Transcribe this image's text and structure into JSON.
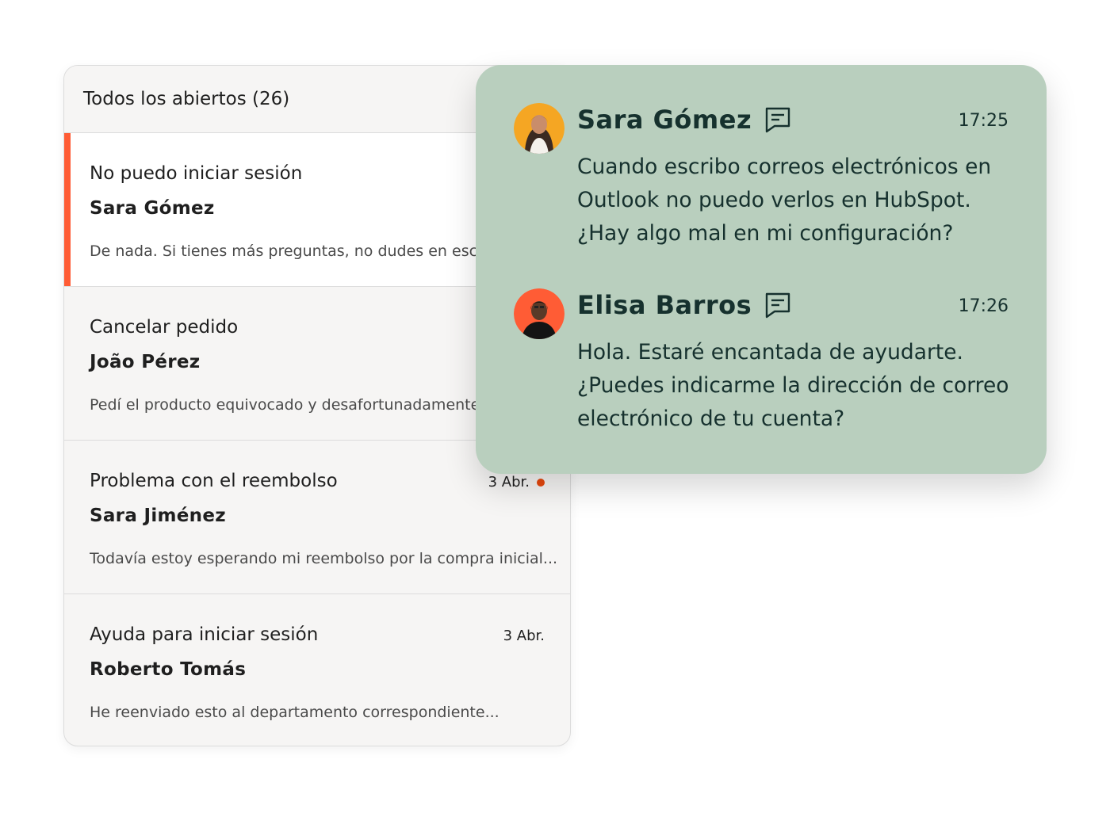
{
  "inbox": {
    "title": "Todos los abiertos (26)",
    "tickets": [
      {
        "subject": "No puedo iniciar sesión",
        "name": "Sara Gómez",
        "preview": "De nada. Si tienes más preguntas, no dudes en escribirnos...",
        "date": "",
        "active": true,
        "unread": false
      },
      {
        "subject": "Cancelar pedido",
        "name": "João Pérez",
        "preview": "Pedí el producto equivocado y desafortunadamente...",
        "date": "",
        "active": false,
        "unread": false
      },
      {
        "subject": "Problema con el reembolso",
        "name": "Sara Jiménez",
        "preview": "Todavía estoy esperando mi reembolso por la compra inicial...",
        "date": "3 Abr.",
        "active": false,
        "unread": true
      },
      {
        "subject": "Ayuda para iniciar sesión",
        "name": "Roberto Tomás",
        "preview": "He reenviado esto al departamento correspondiente...",
        "date": "3 Abr.",
        "active": false,
        "unread": false
      }
    ]
  },
  "chat": {
    "messages": [
      {
        "name": "Sara Gómez",
        "time": "17:25",
        "text": "Cuando escribo correos electrónicos en Outlook no puedo verlos en HubSpot. ¿Hay algo mal en mi configuración?",
        "avatar_bg": "#f5a623"
      },
      {
        "name": "Elisa Barros",
        "time": "17:26",
        "text": "Hola. Estaré encantada de ayudarte. ¿Puedes indicarme la dirección de correo electrónico de tu cuenta?",
        "avatar_bg": "#ff5c35"
      }
    ]
  },
  "colors": {
    "accent": "#ff5c35",
    "unread_dot": "#e8480e",
    "chat_bg": "#b9cfbe",
    "chat_text": "#16312e"
  }
}
